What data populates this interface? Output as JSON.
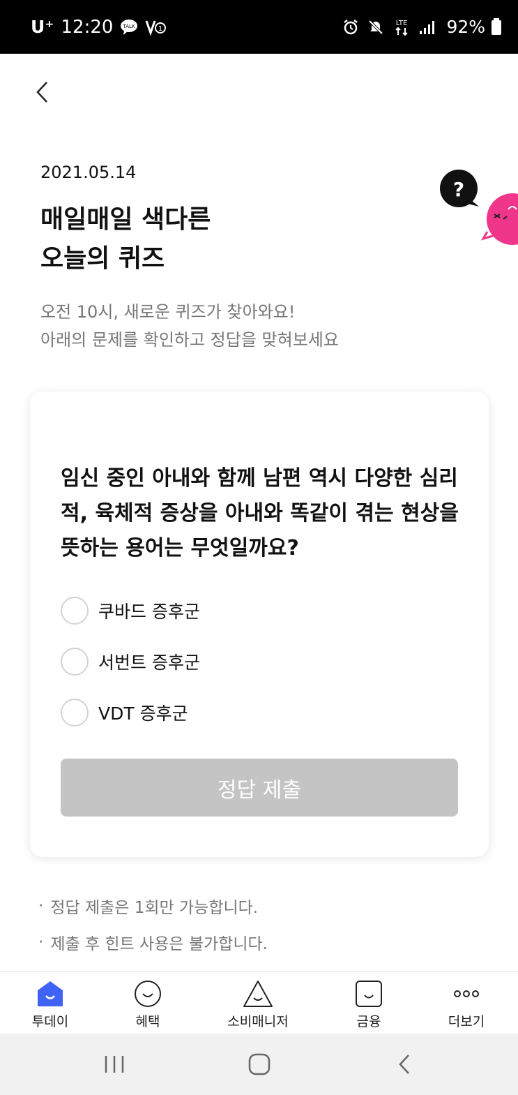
{
  "status_bar": {
    "carrier": "U⁺",
    "time": "12:20",
    "network": "LTE",
    "battery": "92%"
  },
  "header": {
    "date": "2021.05.14",
    "title_line1": "매일매일 색다른",
    "title_line2": "오늘의 퀴즈",
    "subtitle_line1": "오전 10시, 새로운 퀴즈가 찾아와요!",
    "subtitle_line2": "아래의 문제를 확인하고 정답을 맞혀보세요"
  },
  "quiz": {
    "question": "임신 중인 아내와 함께 남편 역시 다양한 심리적, 육체적 증상을 아내와 똑같이 겪는 현상을 뜻하는 용어는 무엇일까요?",
    "options": [
      "쿠바드 증후군",
      "서번트 증후군",
      "VDT 증후군"
    ],
    "submit_label": "정답 제출"
  },
  "notes": [
    "정답 제출은 1회만 가능합니다.",
    "제출 후 힌트 사용은 불가합니다."
  ],
  "bottom_nav": {
    "items": [
      {
        "label": "투데이",
        "icon": "today-icon",
        "active": true
      },
      {
        "label": "혜택",
        "icon": "benefit-icon"
      },
      {
        "label": "소비매니저",
        "icon": "spending-manager-icon"
      },
      {
        "label": "금융",
        "icon": "finance-icon"
      },
      {
        "label": "더보기",
        "icon": "more-icon"
      }
    ]
  },
  "colors": {
    "accent": "#3f63f5",
    "mascot_pink": "#f0368a",
    "button_disabled": "#c4c4c4"
  }
}
